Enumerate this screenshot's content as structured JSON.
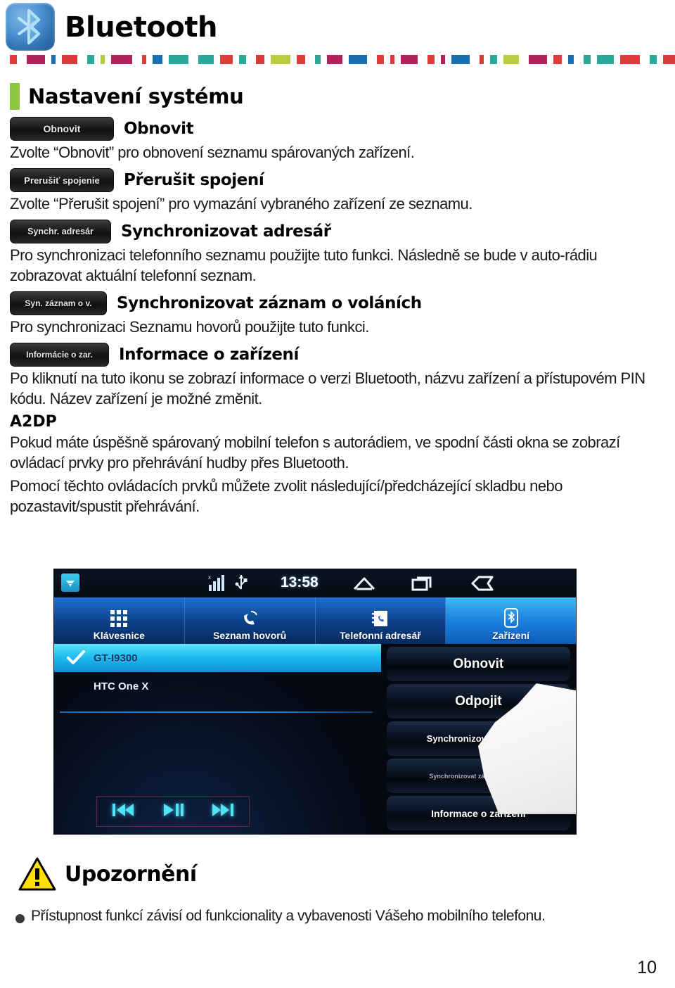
{
  "header": {
    "title": "Bluetooth",
    "logo_icon": "bluetooth-icon",
    "strip_colors": [
      "#e03c3c",
      "#b5205e",
      "#1a6fb0",
      "#d93a3a",
      "#2aa89a",
      "#b9cc3e",
      "#b5205e",
      "#e03c3c",
      "#1a6fb0",
      "#2aa89a",
      "#2aa89a",
      "#e03c3c",
      "#2aa89a",
      "#d93a3a",
      "#b9cc3e",
      "#e03c3c",
      "#2aa89a",
      "#b5205e",
      "#1a6fb0",
      "#e03c3c",
      "#d93a3a",
      "#b5205e"
    ]
  },
  "section": {
    "title": "Nastavení systému",
    "accent_color": "#8dc63f"
  },
  "items": [
    {
      "button_label": "Obnovit",
      "title": "Obnovit",
      "paragraphs": [
        "Zvolte “Obnovit” pro obnovení seznamu spárovaných zařízení."
      ]
    },
    {
      "button_label": "Prerušiť spojenie",
      "title": "Přerušit spojení",
      "paragraphs": [
        "Zvolte “Přerušit spojení” pro vymazání vybraného zařízení ze seznamu."
      ]
    },
    {
      "button_label": "Synchr. adresár",
      "title": "Synchronizovat adresář",
      "paragraphs": [
        "Pro synchronizaci telefonního seznamu použijte tuto funkci. Následně se bude v auto-rádiu zobrazovat aktuální telefonní seznam."
      ]
    },
    {
      "button_label": "Syn. záznam o v.",
      "title": "Synchronizovat záznam o voláních",
      "paragraphs": [
        "Pro synchronizaci Seznamu hovorů použijte tuto funkci."
      ]
    },
    {
      "button_label": "Informácie o zar.",
      "title": "Informace o zařízení",
      "paragraphs": [
        "Po kliknutí na tuto ikonu se zobrazí informace o verzi Bluetooth, názvu zařízení a přístupovém PIN kódu. Název zařízení je možné změnit."
      ]
    }
  ],
  "a2dp": {
    "title": "A2DP",
    "paragraph1": "Pokud máte úspěšně spárovaný mobilní telefon s autorádiem, ve spodní části okna se zobrazí ovládací prvky pro přehrávání hudby přes Bluetooth.",
    "paragraph2": "Pomocí těchto ovládacích prvků můžete zvolit následující/předcházející skladbu nebo pozastavit/spustit přehrávání."
  },
  "screenshot": {
    "status": {
      "time": "13:58",
      "wifi_icon": "wifi-icon",
      "signal_icon": "signal-bars-icon",
      "usb_icon": "usb-icon",
      "home_icon": "home-icon",
      "recents_icon": "recents-icon",
      "back_icon": "back-icon"
    },
    "tabs": [
      {
        "label": "Klávesnice",
        "icon": "keypad-icon",
        "active": false
      },
      {
        "label": "Seznam hovorů",
        "icon": "call-log-icon",
        "active": false
      },
      {
        "label": "Telefonní adresář",
        "icon": "phonebook-icon",
        "active": false
      },
      {
        "label": "Zařízení",
        "icon": "device-bluetooth-icon",
        "active": true
      }
    ],
    "devices": [
      {
        "name": "GT-I9300",
        "selected": true,
        "check_icon": "check-icon"
      },
      {
        "name": "HTC One X",
        "selected": false
      }
    ],
    "media_controls": [
      {
        "icon": "previous-track-icon",
        "glyph": "⏮"
      },
      {
        "icon": "play-pause-icon",
        "glyph": "⏯"
      },
      {
        "icon": "next-track-icon",
        "glyph": "⏭"
      }
    ],
    "side_buttons": [
      "Obnovit",
      "Odpojit",
      "Synchronizovat adresář",
      "Synchronizovat záznamy hovorů",
      "Informace o zařízení"
    ],
    "pointer_icon": "hand-pointer-icon"
  },
  "warning": {
    "icon": "warning-triangle-icon",
    "title": "Upozornění",
    "bullets": [
      "Přístupnost funkcí závisí od funkcionality a vybavenosti Vášeho mobilního telefonu."
    ]
  },
  "footer": {
    "page_number": "10"
  }
}
